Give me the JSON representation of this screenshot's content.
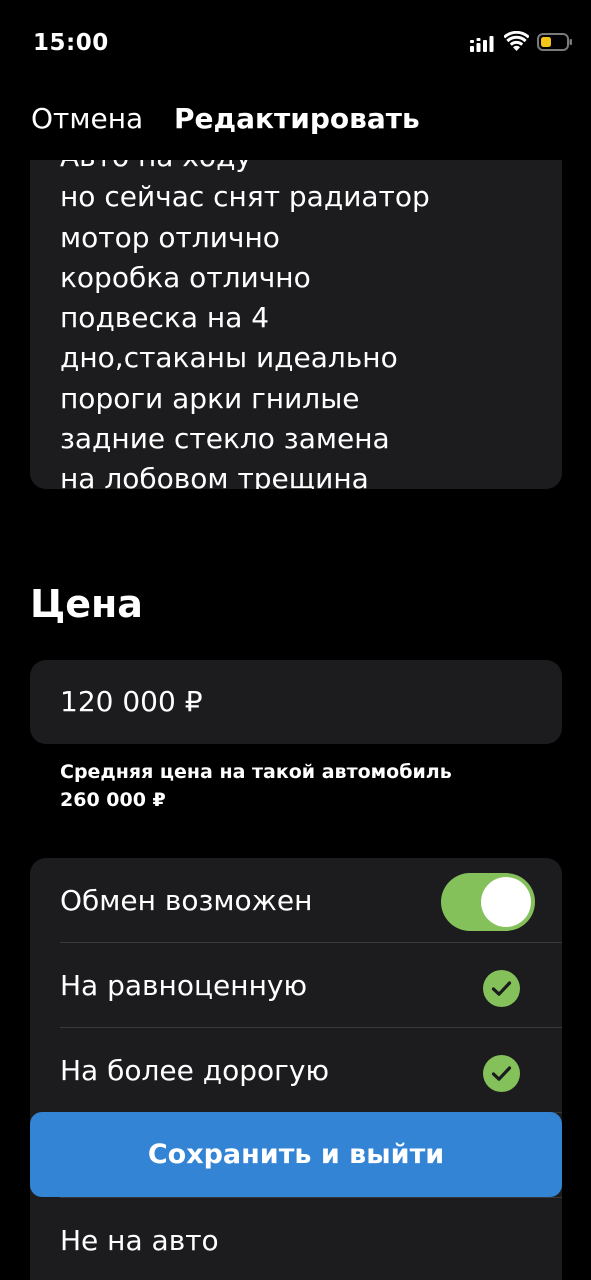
{
  "status_bar": {
    "time": "15:00",
    "battery_color": "#f5c518"
  },
  "nav": {
    "cancel_label": "Отмена",
    "title": "Редактировать"
  },
  "description": {
    "lines": [
      "Авто на ходу",
      "но сейчас снят радиатор",
      "мотор отлично",
      "коробка отлично",
      "подвеска на 4",
      "дно,стаканы идеально",
      "пороги арки гнилые",
      "задние стекло замена",
      "на лобовом трещина"
    ]
  },
  "price": {
    "heading": "Цена",
    "value": "120 000 ₽",
    "avg_label": "Средняя цена на такой автомобиль",
    "avg_value": "260 000 ₽"
  },
  "exchange": {
    "toggle_label": "Обмен возможен",
    "toggle_on": true,
    "accent_color": "#84c15a",
    "options": [
      {
        "label": "На равноценную",
        "checked": true
      },
      {
        "label": "На более дорогую",
        "checked": true
      },
      {
        "label": "",
        "checked": false
      },
      {
        "label": "Не на авто",
        "checked": false
      }
    ]
  },
  "footer": {
    "save_label": "Сохранить и выйти",
    "button_color": "#3484d6"
  }
}
